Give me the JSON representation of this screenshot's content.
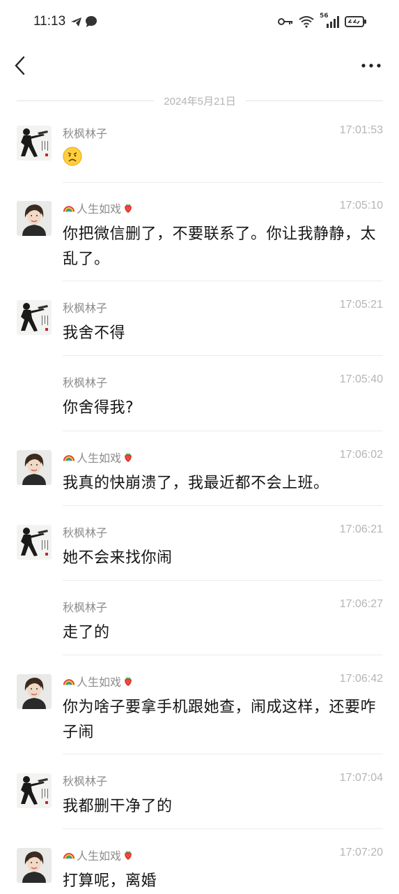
{
  "status": {
    "time": "11:13",
    "network_label": "56"
  },
  "date_separator": "2024年5月21日",
  "senders": {
    "a": {
      "name": "秋枫林子"
    },
    "b": {
      "name": "人生如戏",
      "prefix_icon": "rainbow-icon",
      "suffix_icon": "strawberry-icon"
    }
  },
  "messages": [
    {
      "sender": "秋枫林子",
      "time": "17:01:53",
      "text": "",
      "emoji": "frown-emoji-icon"
    },
    {
      "sender": "人生如戏",
      "time": "17:05:10",
      "text": "你把微信删了，不要联系了。你让我静静，太乱了。"
    },
    {
      "sender": "秋枫林子",
      "time": "17:05:21",
      "text": "我舍不得"
    },
    {
      "sender": "秋枫林子",
      "time": "17:05:40",
      "text": "你舍得我?"
    },
    {
      "sender": "人生如戏",
      "time": "17:06:02",
      "text": "我真的快崩溃了，我最近都不会上班。"
    },
    {
      "sender": "秋枫林子",
      "time": "17:06:21",
      "text": "她不会来找你闹"
    },
    {
      "sender": "秋枫林子",
      "time": "17:06:27",
      "text": "走了的"
    },
    {
      "sender": "人生如戏",
      "time": "17:06:42",
      "text": "你为啥子要拿手机跟她查，闹成这样，还要咋子闹"
    },
    {
      "sender": "秋枫林子",
      "time": "17:07:04",
      "text": "我都删干净了的"
    },
    {
      "sender": "人生如戏",
      "time": "17:07:20",
      "text": "打算呢，离婚"
    }
  ]
}
